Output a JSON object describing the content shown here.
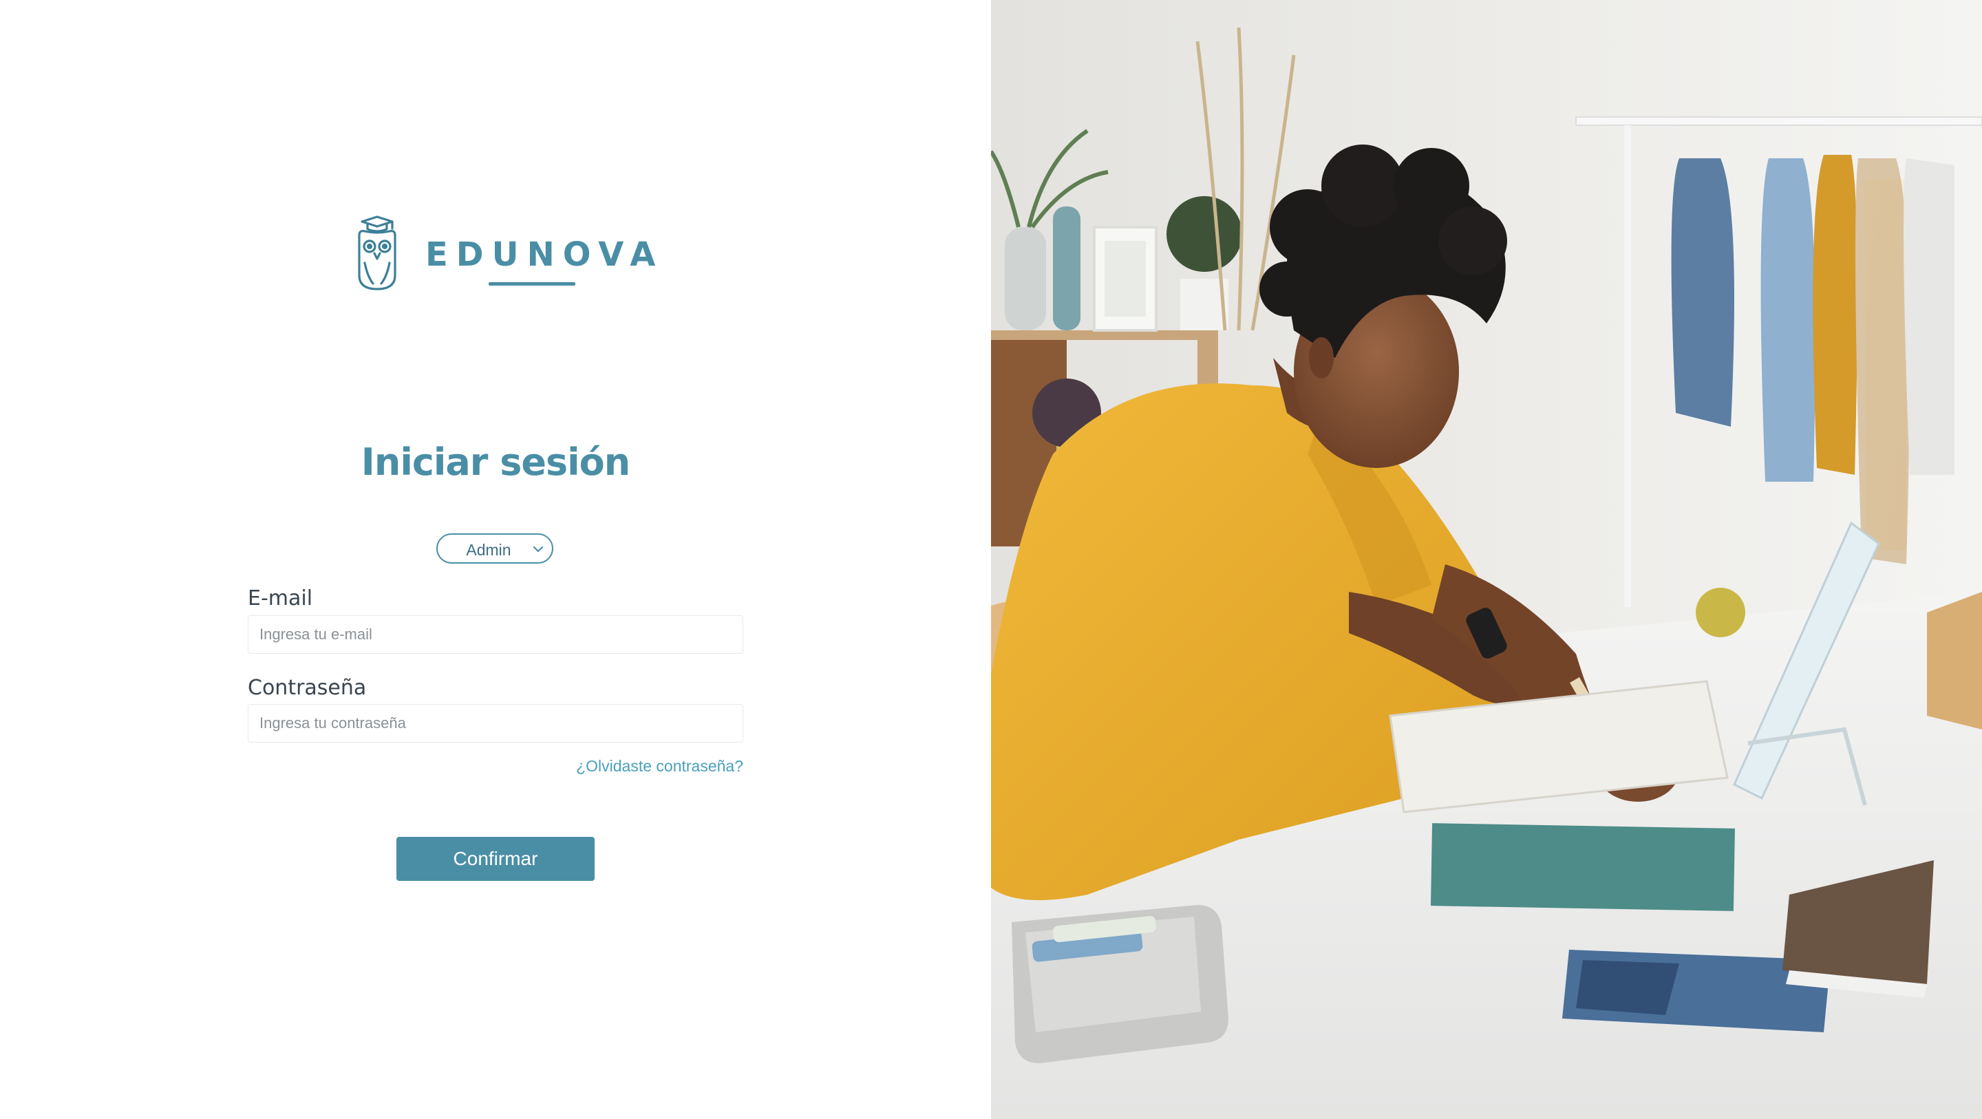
{
  "brand": {
    "name": "EDUNOVA",
    "color": "#4a8ea6"
  },
  "login": {
    "title": "Iniciar sesión",
    "role": {
      "selected": "Admin"
    },
    "email": {
      "label": "E-mail",
      "placeholder": "Ingresa tu e-mail",
      "value": ""
    },
    "password": {
      "label": "Contraseña",
      "placeholder": "Ingresa tu contraseña",
      "value": ""
    },
    "forgot_link": "¿Olvidaste contraseña?",
    "confirm_label": "Confirmar"
  },
  "hero_image": {
    "subject": "student writing at a desk"
  },
  "colors": {
    "accent": "#4a8ea6",
    "link": "#4a9fbf",
    "text": "#3a4550"
  }
}
